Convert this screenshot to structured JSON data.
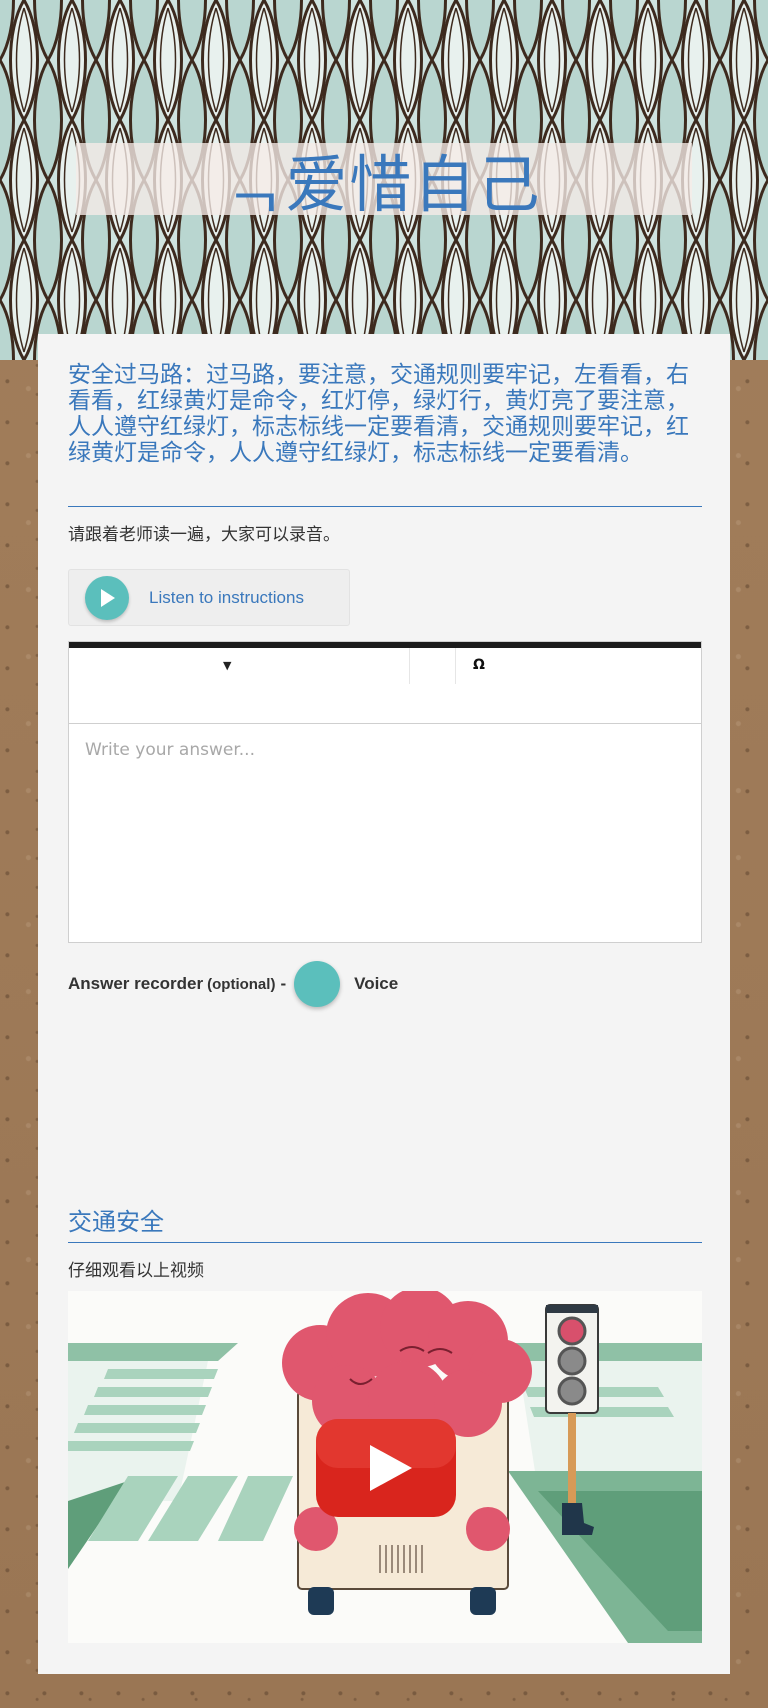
{
  "header": {
    "title": "ᆨ爱惜自己"
  },
  "question1": {
    "title": "安全过马路：过马路，要注意，交通规则要牢记，左看看，右看看，红绿黄灯是命令，红灯停，绿灯行，黄灯亮了要注意，人人遵守红绿灯，标志标线一定要看清，交通规则要牢记，红绿黄灯是命令，人人遵守红绿灯，标志标线一定要看清。",
    "description": "请跟着老师读一遍，大家可以录音。",
    "listen_label": "Listen to instructions",
    "editor": {
      "omega": "Ω",
      "placeholder": "Write your answer..."
    },
    "recorder": {
      "label": "Answer recorder",
      "optional": "(optional)",
      "dash": "-",
      "voice": "Voice"
    }
  },
  "question2": {
    "title": "交通安全",
    "description": "仔细观看以上视频"
  },
  "colors": {
    "accent": "#3a78bc",
    "teal": "#5bbfbc",
    "card": "#f4f4f4",
    "youtube_red": "#d9251d"
  }
}
